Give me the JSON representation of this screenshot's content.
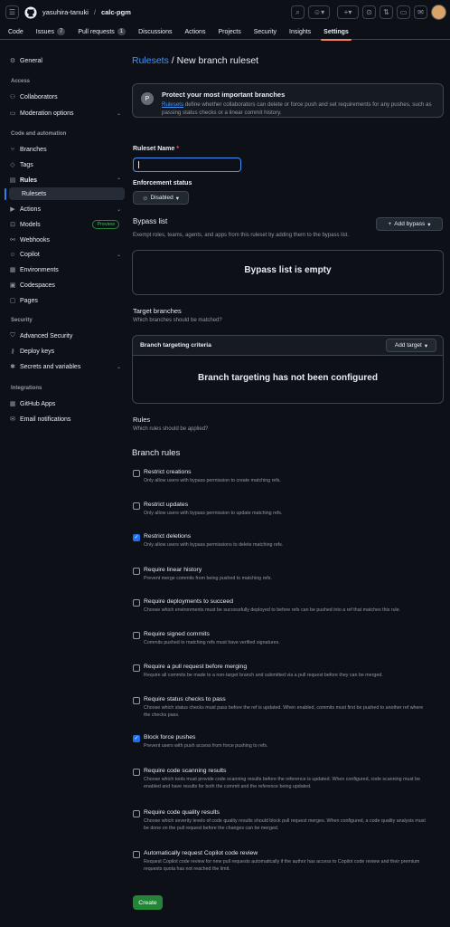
{
  "header": {
    "owner": "yasuhira-tanuki",
    "separator": "/",
    "repo": "calc-pgm"
  },
  "tabs": [
    {
      "label": "Code"
    },
    {
      "label": "Issues",
      "count": "7"
    },
    {
      "label": "Pull requests",
      "count": "1"
    },
    {
      "label": "Discussions"
    },
    {
      "label": "Actions"
    },
    {
      "label": "Projects"
    },
    {
      "label": "Security"
    },
    {
      "label": "Insights"
    },
    {
      "label": "Settings"
    }
  ],
  "sidebar": {
    "general": "General",
    "access_head": "Access",
    "collaborators": "Collaborators",
    "moderation": "Moderation options",
    "code_head": "Code and automation",
    "branches": "Branches",
    "tags": "Tags",
    "rules": "Rules",
    "rulesets": "Rulesets",
    "actions": "Actions",
    "models": "Models",
    "preview": "Preview",
    "webhooks": "Webhooks",
    "copilot": "Copilot",
    "environments": "Environments",
    "codespaces": "Codespaces",
    "pages": "Pages",
    "security_head": "Security",
    "adv_security": "Advanced Security",
    "deploy_keys": "Deploy keys",
    "secrets": "Secrets and variables",
    "integrations_head": "Integrations",
    "github_apps": "GitHub Apps",
    "email": "Email notifications"
  },
  "main": {
    "breadcrumb_link": "Rulesets",
    "breadcrumb_rest": " / New branch ruleset",
    "flash_title": "Protect your most important branches",
    "flash_link": "Rulesets",
    "flash_desc": " define whether collaborators can delete or force push and set requirements for any pushes, such as passing status checks or a linear commit history.",
    "ruleset_name_label": "Ruleset Name",
    "required_mark": "*",
    "enforcement_label": "Enforcement status",
    "enforcement_value": "Disabled",
    "bypass_label": "Bypass list",
    "add_bypass": "Add bypass",
    "bypass_desc": "Exempt roles, teams, agents, and apps from this ruleset by adding them to the bypass list.",
    "bypass_empty": "Bypass list is empty",
    "target_label": "Target branches",
    "target_desc": "Which branches should be matched?",
    "criteria_title": "Branch targeting criteria",
    "add_target": "Add target",
    "target_empty": "Branch targeting has not been configured",
    "rules_label": "Rules",
    "rules_desc": "Which rules should be applied?",
    "branch_rules": "Branch rules",
    "create": "Create"
  },
  "rules": [
    {
      "title": "Restrict creations",
      "desc": "Only allow users with bypass permission to create matching refs.",
      "checked": false
    },
    {
      "title": "Restrict updates",
      "desc": "Only allow users with bypass permission to update matching refs.",
      "checked": false
    },
    {
      "title": "Restrict deletions",
      "desc": "Only allow users with bypass permissions to delete matching refs.",
      "checked": true
    },
    {
      "title": "Require linear history",
      "desc": "Prevent merge commits from being pushed to matching refs.",
      "checked": false
    },
    {
      "title": "Require deployments to succeed",
      "desc": "Choose which environments must be successfully deployed to before refs can be pushed into a ref that matches this rule.",
      "checked": false
    },
    {
      "title": "Require signed commits",
      "desc": "Commits pushed to matching refs must have verified signatures.",
      "checked": false
    },
    {
      "title": "Require a pull request before merging",
      "desc": "Require all commits be made to a non-target branch and submitted via a pull request before they can be merged.",
      "checked": false
    },
    {
      "title": "Require status checks to pass",
      "desc": "Choose which status checks must pass before the ref is updated. When enabled, commits must first be pushed to another ref where the checks pass.",
      "checked": false
    },
    {
      "title": "Block force pushes",
      "desc": "Prevent users with push access from force pushing to refs.",
      "checked": true
    },
    {
      "title": "Require code scanning results",
      "desc": "Choose which tools must provide code scanning results before the reference is updated. When configured, code scanning must be enabled and have results for both the commit and the reference being updated.",
      "checked": false
    },
    {
      "title": "Require code quality results",
      "desc": "Choose which severity levels of code quality results should block pull request merges. When configured, a code quality analysis must be done on the pull request before the changes can be merged.",
      "checked": false
    },
    {
      "title": "Automatically request Copilot code review",
      "desc": "Request Copilot code review for new pull requests automatically if the author has access to Copilot code review and their premium requests quota has not reached the limit.",
      "checked": false
    }
  ]
}
